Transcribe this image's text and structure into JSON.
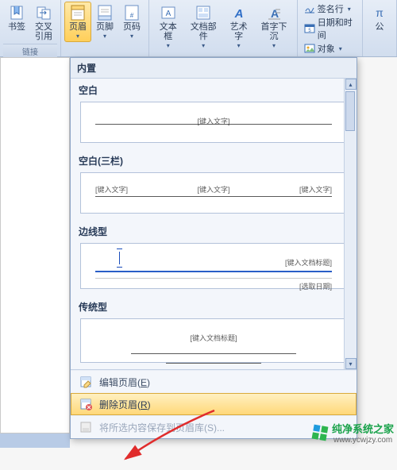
{
  "ribbon": {
    "group1_label": "链接",
    "bookmark": "书签",
    "crossref": "交叉\n引用",
    "header": "页眉",
    "footer": "页脚",
    "pagenum": "页码",
    "textbox": "文本框",
    "quickparts": "文档部件",
    "wordart": "艺术字",
    "dropcap": "首字下沉",
    "sigline": "签名行",
    "datetime": "日期和时间",
    "object": "对象",
    "equation": "公"
  },
  "panel": {
    "builtin": "内置",
    "sections": [
      {
        "title": "空白",
        "placeholder_center": "[键入文字]"
      },
      {
        "title": "空白(三栏)",
        "placeholder_l": "[键入文字]",
        "placeholder_c": "[键入文字]",
        "placeholder_r": "[键入文字]"
      },
      {
        "title": "边线型",
        "placeholder_title": "[键入文档标题]",
        "placeholder_date": "[选取日期]"
      },
      {
        "title": "传统型",
        "placeholder_title": "[键入文档标题]"
      }
    ],
    "menu": {
      "edit": "编辑页眉(E)",
      "remove": "删除页眉(R)",
      "save": "将所选内容保存到页眉库(S)..."
    }
  },
  "watermark": {
    "brand": "纯净系统之家",
    "url": "www.ycwjzy.com"
  }
}
